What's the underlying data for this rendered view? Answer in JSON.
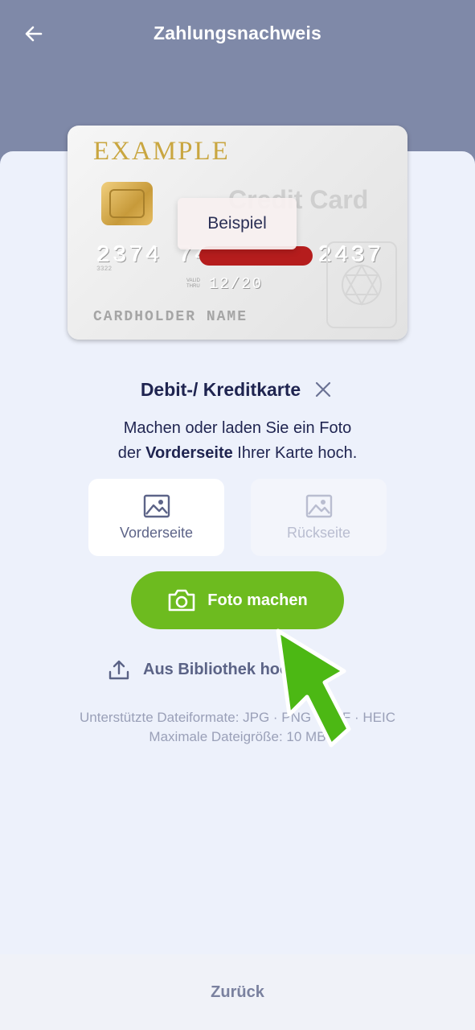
{
  "header": {
    "title": "Zahlungsnachweis",
    "back_icon": "arrow-left-icon"
  },
  "card": {
    "brand": "EXAMPLE",
    "type": "Credit Card",
    "number_start": "2374 74",
    "number_end": "2437",
    "small_number": "3322",
    "valid_label_1": "VALID",
    "valid_label_2": "THRU",
    "expiry": "12/20",
    "holder": "CARDHOLDER NAME",
    "example_tag": "Beispiel"
  },
  "document": {
    "title": "Debit-/ Kreditkarte",
    "close_icon": "close-icon",
    "instruction_line1": "Machen oder laden Sie ein Foto",
    "instruction_pre": "der ",
    "instruction_bold": "Vorderseite",
    "instruction_post": " Ihrer Karte hoch."
  },
  "sides": {
    "front_label": "Vorderseite",
    "back_label": "Rückseite",
    "icon": "image-icon"
  },
  "actions": {
    "take_photo": "Foto machen",
    "camera_icon": "camera-icon",
    "upload_library": "Aus Bibliothek hochladen",
    "upload_icon": "upload-icon"
  },
  "info": {
    "formats": "Unterstützte Dateiformate: JPG · PNG · PDF · HEIC",
    "max_size": "Maximale Dateigröße: 10 MB"
  },
  "footer": {
    "back_label": "Zurück"
  },
  "colors": {
    "header_bg": "#7f89a8",
    "sheet_bg": "#edf1fb",
    "primary_green": "#6dbb1f",
    "arrow_green": "#4cb814",
    "text_dark": "#1f2450"
  }
}
